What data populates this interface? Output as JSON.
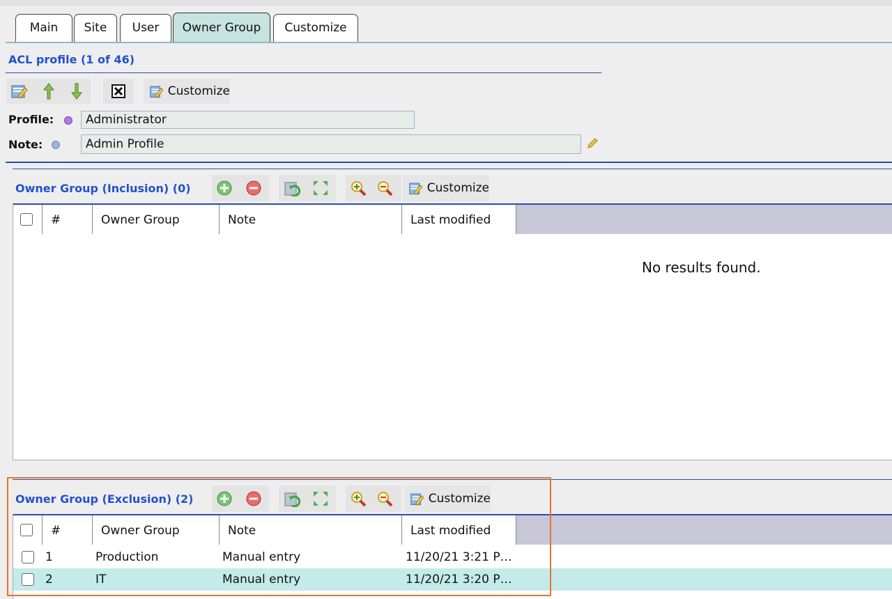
{
  "tabs": [
    {
      "label": "Main"
    },
    {
      "label": "Site"
    },
    {
      "label": "User"
    },
    {
      "label": "Owner Group",
      "active": true
    },
    {
      "label": "Customize"
    }
  ],
  "acl": {
    "title": "ACL profile (1 of 46)",
    "customize_label": "Customize",
    "profile_label": "Profile:",
    "profile_value": "Administrator",
    "note_label": "Note:",
    "note_value": "Admin Profile"
  },
  "inclusion": {
    "title": "Owner Group (Inclusion) (0)",
    "customize_label": "Customize",
    "columns": [
      "#",
      "Owner Group",
      "Note",
      "Last modified"
    ],
    "empty_text": "No results found."
  },
  "exclusion": {
    "title": "Owner Group (Exclusion) (2)",
    "customize_label": "Customize",
    "columns": [
      "#",
      "Owner Group",
      "Note",
      "Last modified"
    ],
    "rows": [
      {
        "num": "1",
        "group": "Production",
        "note": "Manual entry",
        "modified": "11/20/21 3:21 P…"
      },
      {
        "num": "2",
        "group": "IT",
        "note": "Manual entry",
        "modified": "11/20/21 3:20 P…"
      }
    ]
  },
  "colors": {
    "accent": "#2251cc",
    "active_tab": "#c7e3df",
    "header_bg": "#c7c7d8",
    "alt_row": "#c4ebea",
    "highlight": "#e8732a"
  }
}
